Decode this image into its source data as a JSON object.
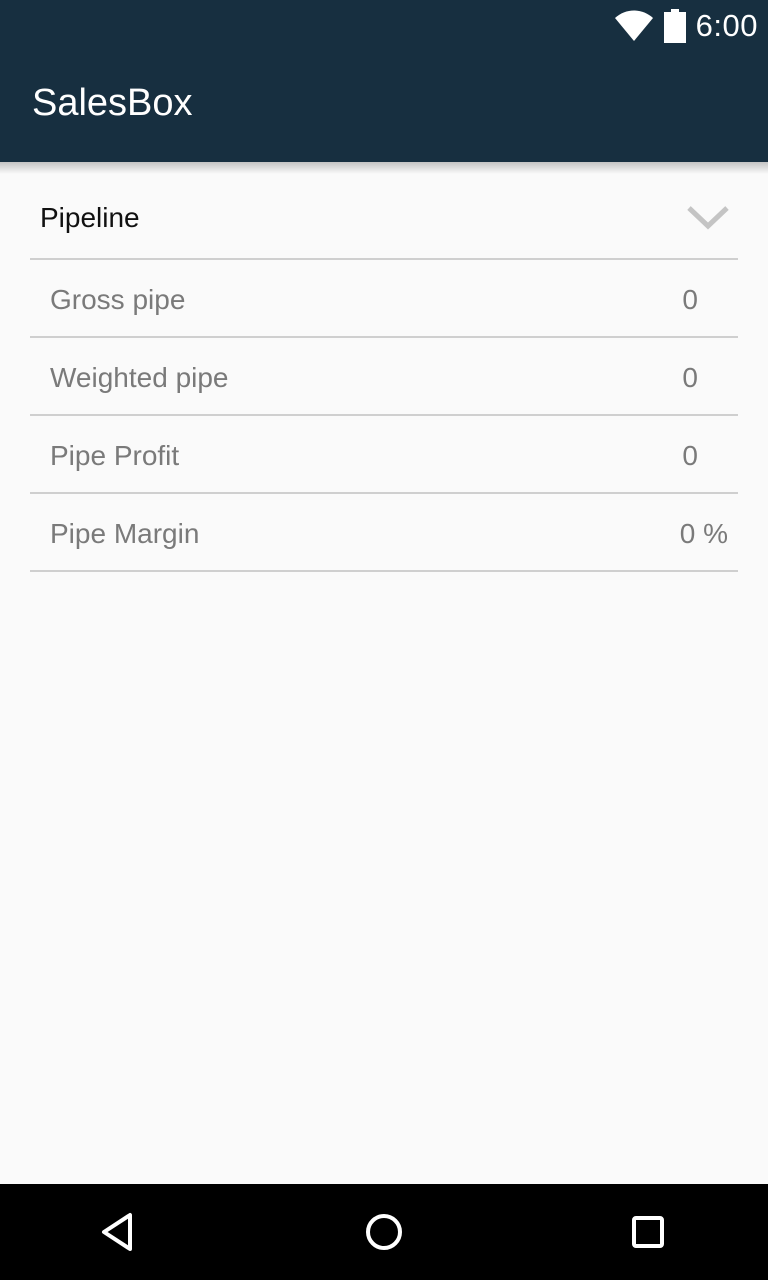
{
  "status_bar": {
    "time": "6:00",
    "icons": [
      "wifi-icon",
      "battery-icon"
    ]
  },
  "app_bar": {
    "title": "SalesBox"
  },
  "pipeline": {
    "title": "Pipeline",
    "expand_icon": "chevron-down-icon",
    "rows": [
      {
        "label": "Gross pipe",
        "value": "0"
      },
      {
        "label": "Weighted pipe",
        "value": "0"
      },
      {
        "label": "Pipe Profit",
        "value": "0"
      },
      {
        "label": "Pipe Margin",
        "value": "0 %"
      }
    ]
  },
  "nav_bar": {
    "buttons": [
      "back-icon",
      "home-icon",
      "recents-icon"
    ]
  },
  "colors": {
    "app_bar": "#172f40",
    "background": "#fafafa",
    "divider": "#cfcfcf",
    "secondary_text": "#7a7a7a"
  }
}
